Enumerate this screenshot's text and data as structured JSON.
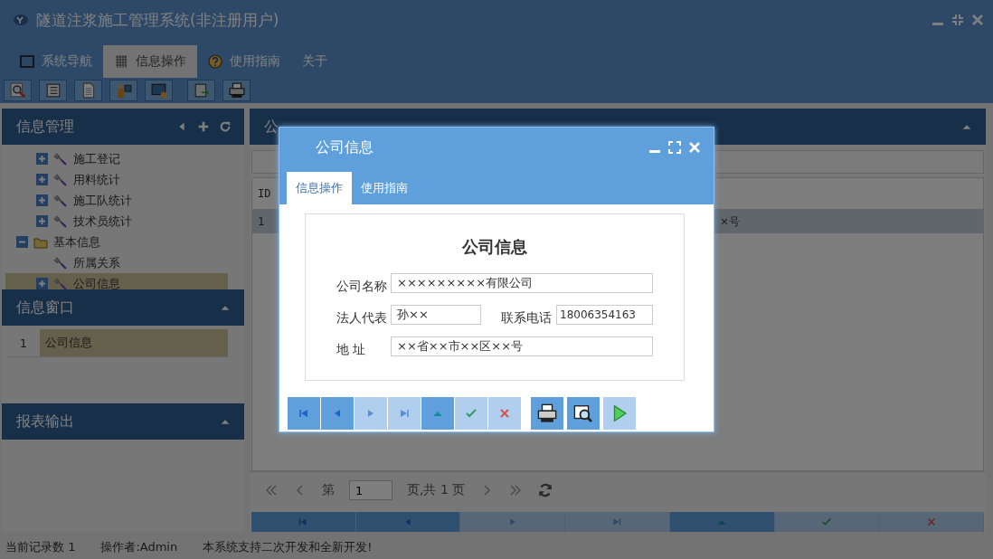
{
  "window": {
    "title": "隧道注浆施工管理系统(非注册用户)"
  },
  "main_tabs": [
    {
      "label": "系统导航",
      "selected": false
    },
    {
      "label": "信息操作",
      "selected": true
    },
    {
      "label": "使用指南",
      "selected": false
    },
    {
      "label": "关于",
      "selected": false
    }
  ],
  "toolbar": [
    {
      "kind": "search"
    },
    {
      "kind": "list"
    },
    {
      "kind": "document"
    },
    {
      "kind": "person"
    },
    {
      "kind": "monitor"
    },
    {
      "kind": "export"
    },
    {
      "kind": "print"
    }
  ],
  "sidebar": {
    "panels": [
      {
        "kind": "tree",
        "title": "信息管理",
        "tree": [
          {
            "children": [
              {
                "label": "施工登记",
                "expanded": false,
                "selected": false
              },
              {
                "label": "用料统计",
                "expanded": false,
                "selected": false
              },
              {
                "label": "施工队统计",
                "expanded": false,
                "selected": false
              },
              {
                "label": "技术员统计",
                "expanded": false,
                "selected": false
              }
            ]
          },
          {
            "label": "基本信息",
            "kind": "folder",
            "expanded": true,
            "selected": false,
            "children": [
              {
                "label": "所属关系",
                "selected": false
              },
              {
                "label": "公司信息",
                "expanded": false,
                "selected": true
              }
            ]
          }
        ]
      },
      {
        "kind": "list",
        "title": "信息窗口",
        "rows": [
          {
            "index": "1",
            "label": "公司信息",
            "selected": true
          }
        ]
      },
      {
        "kind": "empty",
        "title": "报表输出"
      }
    ]
  },
  "main": {
    "title": "公",
    "table": {
      "columns": [
        "ID"
      ],
      "rows": [
        {
          "cells": [
            "1",
            "×号"
          ],
          "selected": true
        }
      ]
    },
    "pager": {
      "before": "第",
      "page": "1",
      "after": "页,共 1 页"
    },
    "nav_buttons": [
      {
        "kind": "first",
        "disabled": false
      },
      {
        "kind": "prev",
        "disabled": false
      },
      {
        "kind": "next",
        "disabled": true
      },
      {
        "kind": "last",
        "disabled": true
      },
      {
        "kind": "up",
        "disabled": false
      },
      {
        "kind": "check",
        "disabled": true
      },
      {
        "kind": "cross",
        "disabled": true
      }
    ]
  },
  "status_bar": [
    "当前记录数 1",
    "操作者:Admin",
    "本系统支持二次开发和全新开发!"
  ],
  "dialog": {
    "title": "公司信息",
    "tabs": [
      {
        "label": "信息操作",
        "selected": true
      },
      {
        "label": "使用指南",
        "selected": false
      }
    ],
    "form": {
      "heading": "公司信息",
      "rows": [
        [
          {
            "label": "公司名称",
            "value": "×××××××××有限公司"
          }
        ],
        [
          {
            "label": "法人代表",
            "value": "孙××"
          },
          {
            "label": "联系电话",
            "value": "18006354163"
          }
        ],
        [
          {
            "label": "地 址",
            "value": "××省××市××区××号"
          }
        ]
      ]
    },
    "record_buttons": [
      {
        "kind": "first",
        "disabled": false
      },
      {
        "kind": "prev",
        "disabled": false
      },
      {
        "kind": "next",
        "disabled": true
      },
      {
        "kind": "last",
        "disabled": true
      },
      {
        "kind": "up",
        "disabled": false
      },
      {
        "kind": "check",
        "disabled": true
      },
      {
        "kind": "cross",
        "disabled": true
      }
    ],
    "action_buttons": [
      {
        "kind": "print",
        "disabled": false
      },
      {
        "kind": "preview",
        "disabled": false
      },
      {
        "kind": "play",
        "disabled": true
      }
    ]
  }
}
